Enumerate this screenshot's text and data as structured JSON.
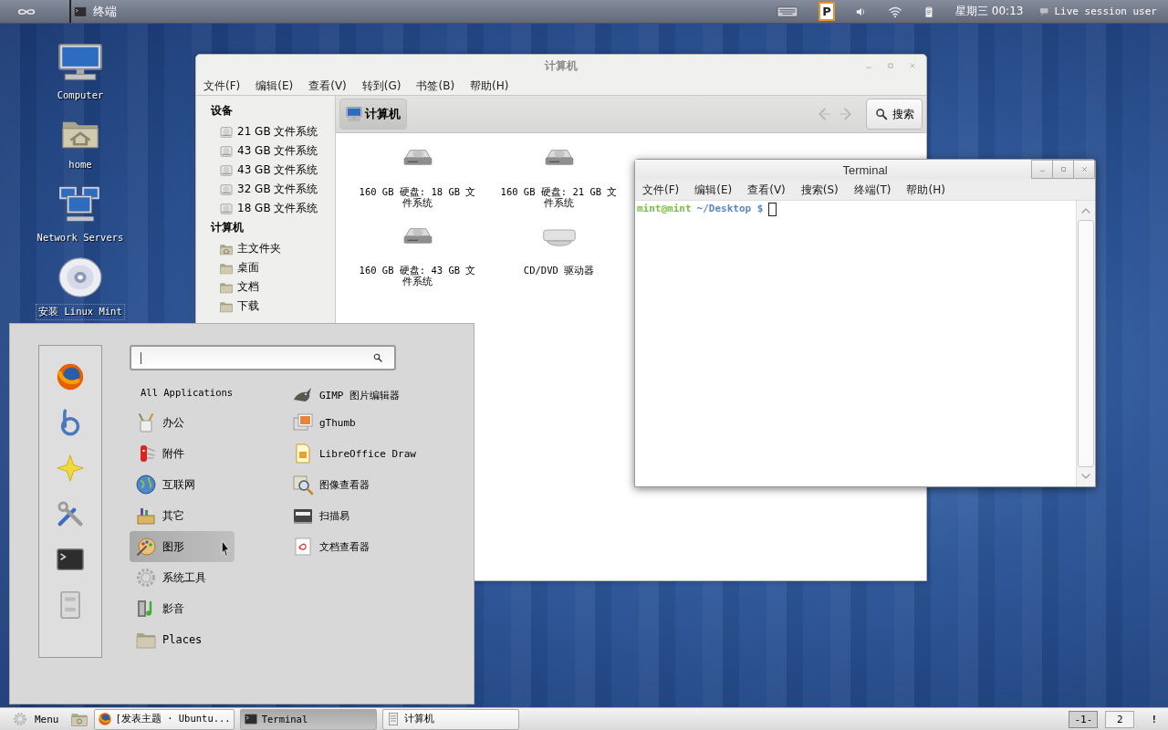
{
  "top_panel": {
    "launcher": "终端",
    "indicator": "P",
    "clock": "星期三 00:13",
    "user": "Live session user"
  },
  "desktop_icons": [
    {
      "label": "Computer"
    },
    {
      "label": "home"
    },
    {
      "label": "Network Servers"
    },
    {
      "label": "安装 Linux Mint"
    }
  ],
  "file_manager": {
    "title": "计算机",
    "menu": [
      "文件(F)",
      "编辑(E)",
      "查看(V)",
      "转到(G)",
      "书签(B)",
      "帮助(H)"
    ],
    "sidebar": [
      {
        "heading": "设备",
        "items": [
          "21 GB 文件系统",
          "43 GB 文件系统",
          "43 GB 文件系统",
          "32 GB 文件系统",
          "18 GB 文件系统"
        ]
      },
      {
        "heading": "计算机",
        "items": [
          "主文件夹",
          "桌面",
          "文档",
          "下载"
        ]
      }
    ],
    "path_button": "计算机",
    "search_button": "搜索",
    "items": [
      {
        "kind": "disk",
        "label": "160 GB 硬盘: 18 GB 文件系统"
      },
      {
        "kind": "disk",
        "label": "160 GB 硬盘: 21 GB 文件系统"
      },
      {
        "kind": "disk",
        "label": "160 GB 硬盘: 43 GB 文件系统"
      },
      {
        "kind": "optical",
        "label": "CD/DVD 驱动器"
      }
    ]
  },
  "terminal": {
    "title": "Terminal",
    "menu": [
      "文件(F)",
      "编辑(E)",
      "查看(V)",
      "搜索(S)",
      "终端(T)",
      "帮助(H)"
    ],
    "prompt_user": "mint@mint",
    "prompt_path": "~/Desktop $"
  },
  "app_menu": {
    "categories": [
      {
        "label": "All Applications",
        "selected": false
      },
      {
        "label": "办公",
        "selected": false
      },
      {
        "label": "附件",
        "selected": false
      },
      {
        "label": "互联网",
        "selected": false
      },
      {
        "label": "其它",
        "selected": false
      },
      {
        "label": "图形",
        "selected": true
      },
      {
        "label": "系统工具",
        "selected": false
      },
      {
        "label": "影音",
        "selected": false
      },
      {
        "label": "Places",
        "selected": false
      }
    ],
    "applications": [
      "GIMP 图片编辑器",
      "gThumb",
      "LibreOffice Draw",
      "图像查看器",
      "扫描易",
      "文档查看器"
    ]
  },
  "taskbar": {
    "menu_button": "Menu",
    "tasks": [
      {
        "label": "[发表主题 · Ubuntu...",
        "selected": false
      },
      {
        "label": "Terminal",
        "selected": true
      },
      {
        "label": "计算机",
        "selected": false
      }
    ],
    "workspaces": [
      {
        "label": "-1-",
        "selected": true
      },
      {
        "label": "2",
        "selected": false
      }
    ],
    "notice": "!"
  }
}
